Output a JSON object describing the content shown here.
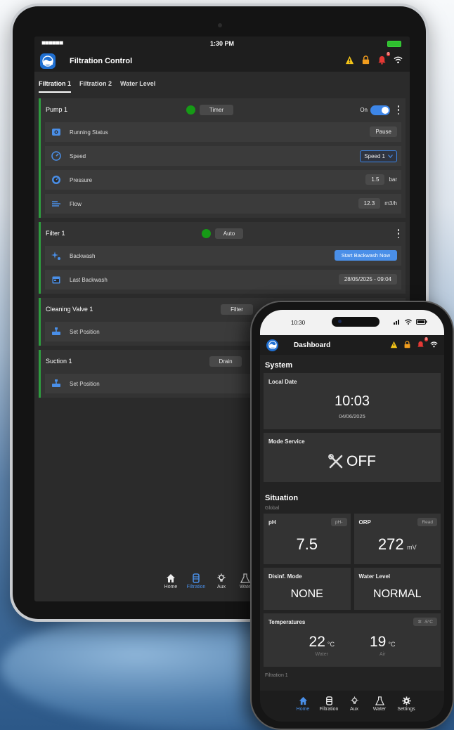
{
  "tablet": {
    "status": {
      "signal": "■■■■■■",
      "time": "1:30 PM"
    },
    "header": {
      "title": "Filtration Control"
    },
    "tabs": [
      "Filtration 1",
      "Filtration 2",
      "Water Level"
    ],
    "pump": {
      "title": "Pump 1",
      "mode": "Timer",
      "toggle_label": "On",
      "rows": [
        {
          "label": "Running Status",
          "value": "Pause"
        },
        {
          "label": "Speed",
          "value": "Speed 1"
        },
        {
          "label": "Pressure",
          "value": "1.5",
          "unit": "bar"
        },
        {
          "label": "Flow",
          "value": "12.3",
          "unit": "m3/h"
        }
      ]
    },
    "filter": {
      "title": "Filter 1",
      "mode": "Auto",
      "rows": [
        {
          "label": "Backwash",
          "value": "Start Backwash Now"
        },
        {
          "label": "Last Backwash",
          "value": "28/05/2025 - 09:04"
        }
      ]
    },
    "cleaning_valve": {
      "title": "Cleaning Valve 1",
      "mode": "Filter",
      "row_label": "Set Position"
    },
    "suction": {
      "title": "Suction 1",
      "mode": "Drain",
      "row_label": "Set Position"
    },
    "nav": [
      "Home",
      "Filtration",
      "Aux",
      "Wate"
    ]
  },
  "phone": {
    "status": {
      "time": "10:30"
    },
    "header": {
      "title": "Dashboard"
    },
    "system": {
      "heading": "System",
      "local_date": {
        "title": "Local Date",
        "time": "10:03",
        "date": "04/06/2025"
      },
      "mode_service": {
        "title": "Mode Service",
        "value": "OFF"
      }
    },
    "situation": {
      "heading": "Situation",
      "sublabel": "Global",
      "ph": {
        "title": "pH",
        "chip": "pH-",
        "value": "7.5"
      },
      "orp": {
        "title": "ORP",
        "chip": "Read",
        "value": "272",
        "unit": "mV"
      },
      "disinf": {
        "title": "Disinf. Mode",
        "value": "NONE"
      },
      "water_level": {
        "title": "Water Level",
        "value": "NORMAL"
      },
      "temperatures": {
        "title": "Temperatures",
        "chip": "-5°C",
        "water": {
          "value": "22",
          "unit": "°C",
          "label": "Water"
        },
        "air": {
          "value": "19",
          "unit": "°C",
          "label": "Air"
        }
      },
      "next_label": "Filtration 1"
    },
    "nav": [
      "Home",
      "Filtration",
      "Aux",
      "Water",
      "Settings"
    ]
  },
  "colors": {
    "accent_blue": "#4a8fe8",
    "status_green": "#169a16",
    "panel_border_green": "#2e9c3f",
    "warning_yellow": "#f5c518",
    "lock_orange": "#f29d1e",
    "alarm_red": "#e53935"
  }
}
